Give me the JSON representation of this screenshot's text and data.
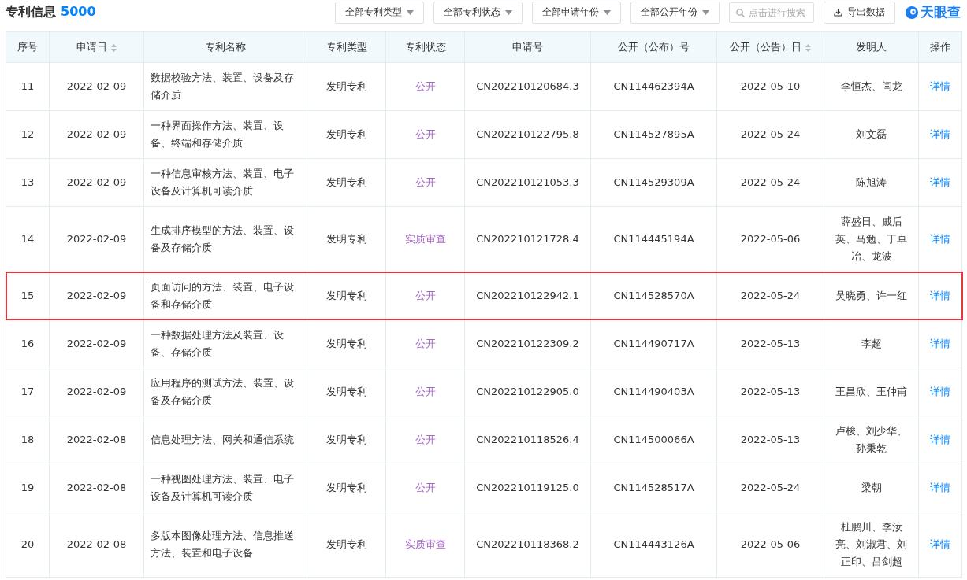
{
  "header": {
    "title": "专利信息",
    "count": "5000",
    "filters": [
      {
        "label": "全部专利类型"
      },
      {
        "label": "全部专利状态"
      },
      {
        "label": "全部申请年份"
      },
      {
        "label": "全部公开年份"
      }
    ],
    "search": {
      "placeholder": "点击进行搜索"
    },
    "export_button": "导出数据",
    "logo": "天眼查"
  },
  "table": {
    "columns": [
      {
        "label": "序号",
        "sortable": false
      },
      {
        "label": "申请日",
        "sortable": true
      },
      {
        "label": "专利名称",
        "sortable": false
      },
      {
        "label": "专利类型",
        "sortable": false
      },
      {
        "label": "专利状态",
        "sortable": false
      },
      {
        "label": "申请号",
        "sortable": false
      },
      {
        "label": "公开（公布）号",
        "sortable": false
      },
      {
        "label": "公开（公告）日",
        "sortable": true
      },
      {
        "label": "发明人",
        "sortable": false
      },
      {
        "label": "操作",
        "sortable": false
      }
    ],
    "rows": [
      {
        "no": "11",
        "filed": "2022-02-09",
        "name": "数据校验方法、装置、设备及存储介质",
        "type": "发明专利",
        "status": "公开",
        "app_no": "CN202210120684.3",
        "pub_no": "CN114462394A",
        "pub_date": "2022-05-10",
        "inventors": "李恒杰、闫龙",
        "action": "详情",
        "highlighted": false
      },
      {
        "no": "12",
        "filed": "2022-02-09",
        "name": "一种界面操作方法、装置、设备、终端和存储介质",
        "type": "发明专利",
        "status": "公开",
        "app_no": "CN202210122795.8",
        "pub_no": "CN114527895A",
        "pub_date": "2022-05-24",
        "inventors": "刘文磊",
        "action": "详情",
        "highlighted": false
      },
      {
        "no": "13",
        "filed": "2022-02-09",
        "name": "一种信息审核方法、装置、电子设备及计算机可读介质",
        "type": "发明专利",
        "status": "公开",
        "app_no": "CN202210121053.3",
        "pub_no": "CN114529309A",
        "pub_date": "2022-05-24",
        "inventors": "陈旭涛",
        "action": "详情",
        "highlighted": false
      },
      {
        "no": "14",
        "filed": "2022-02-09",
        "name": "生成排序模型的方法、装置、设备及存储介质",
        "type": "发明专利",
        "status": "实质审查",
        "app_no": "CN202210121728.4",
        "pub_no": "CN114445194A",
        "pub_date": "2022-05-06",
        "inventors": "薛盛日、戚后英、马勉、丁卓冶、龙波",
        "action": "详情",
        "highlighted": false
      },
      {
        "no": "15",
        "filed": "2022-02-09",
        "name": "页面访问的方法、装置、电子设备和存储介质",
        "type": "发明专利",
        "status": "公开",
        "app_no": "CN202210122942.1",
        "pub_no": "CN114528570A",
        "pub_date": "2022-05-24",
        "inventors": "吴晓勇、许一红",
        "action": "详情",
        "highlighted": true
      },
      {
        "no": "16",
        "filed": "2022-02-09",
        "name": "一种数据处理方法及装置、设备、存储介质",
        "type": "发明专利",
        "status": "公开",
        "app_no": "CN202210122309.2",
        "pub_no": "CN114490717A",
        "pub_date": "2022-05-13",
        "inventors": "李超",
        "action": "详情",
        "highlighted": false
      },
      {
        "no": "17",
        "filed": "2022-02-09",
        "name": "应用程序的测试方法、装置、设备及存储介质",
        "type": "发明专利",
        "status": "公开",
        "app_no": "CN202210122905.0",
        "pub_no": "CN114490403A",
        "pub_date": "2022-05-13",
        "inventors": "王昌欣、王仲甫",
        "action": "详情",
        "highlighted": false
      },
      {
        "no": "18",
        "filed": "2022-02-08",
        "name": "信息处理方法、网关和通信系统",
        "type": "发明专利",
        "status": "公开",
        "app_no": "CN202210118526.4",
        "pub_no": "CN114500066A",
        "pub_date": "2022-05-13",
        "inventors": "卢梭、刘少华、孙秉乾",
        "action": "详情",
        "highlighted": false
      },
      {
        "no": "19",
        "filed": "2022-02-08",
        "name": "一种视图处理方法、装置、电子设备及计算机可读介质",
        "type": "发明专利",
        "status": "公开",
        "app_no": "CN202210119125.0",
        "pub_no": "CN114528517A",
        "pub_date": "2022-05-24",
        "inventors": "梁朝",
        "action": "详情",
        "highlighted": false
      },
      {
        "no": "20",
        "filed": "2022-02-08",
        "name": "多版本图像处理方法、信息推送方法、装置和电子设备",
        "type": "发明专利",
        "status": "实质审查",
        "app_no": "CN202210118368.2",
        "pub_no": "CN114443126A",
        "pub_date": "2022-05-06",
        "inventors": "杜鹏川、李汝亮、刘淑君、刘正印、吕剑超",
        "action": "详情",
        "highlighted": false
      }
    ]
  }
}
